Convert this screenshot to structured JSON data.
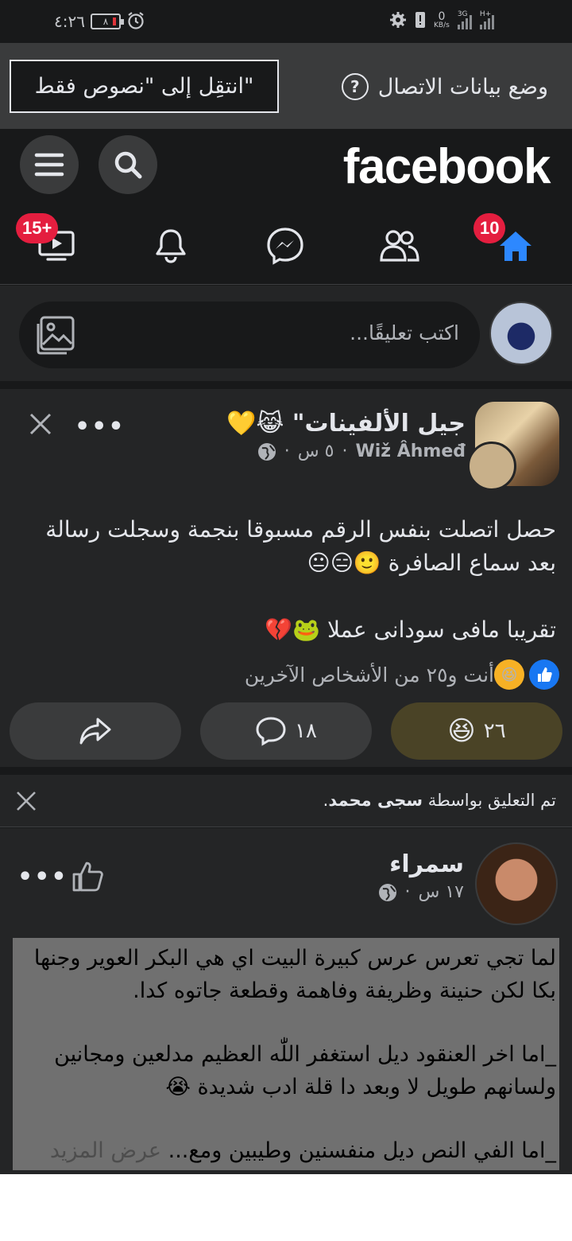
{
  "status_bar": {
    "time": "٤:٢٦",
    "battery": "٨",
    "data_speed": "0",
    "data_speed_unit": "KB/s",
    "network_1": "3G",
    "network_2": "H+"
  },
  "data_bar": {
    "mode_label": "وضع بيانات الاتصال",
    "text_only_button": "انتقِل إلى \"نصوص فقط\"",
    "help_icon": "?"
  },
  "header": {
    "logo": "facebook"
  },
  "nav": {
    "home_badge": "10",
    "watch_badge": "15+"
  },
  "composer": {
    "placeholder": "اكتب تعليقًا..."
  },
  "post": {
    "group_name": "جيل الألفينات\"",
    "group_emojis": "😹💛",
    "author": "Wiž Âhmeđ",
    "time": "٥ س",
    "body_line1": "حصل اتصلت بنفس الرقم مسبوقا بنجمة وسجلت رسالة",
    "body_line2": "بعد سماع الصافرة 🙂😑😐",
    "body_line3": "تقريبا مافى سودانى عملا 🐸💔",
    "reactions_summary": "أنت و٢٥ من الأشخاص الآخرين",
    "reaction_count": "٢٦",
    "comment_count": "١٨",
    "reaction_emoji": "😆",
    "like_icon": "👍"
  },
  "comment_notice": {
    "prefix": "تم التعليق بواسطة ",
    "name": "سجى محمد",
    "suffix": "."
  },
  "post2": {
    "author": "سمراء",
    "time": "١٧ س",
    "para1_line1": "لما تجي تعرس عرس كبيرة البيت اي هي البكر العوير وجنها",
    "para1_line2": "بكا لكن حنينة وظريفة وفاهمة وقطعة جاتوه كدا.",
    "para2_line1": "_اما اخر العنقود ديل استغفر اللّٰه العظيم مدلعين ومجانين",
    "para2_line2": "ولسانهم طويل لا وبعد دا قلة ادب شديدة 😭",
    "para3_line1": "_اما الفي النص ديل منفسنين وطيبين ومع...",
    "see_more": " عرض المزيد"
  }
}
